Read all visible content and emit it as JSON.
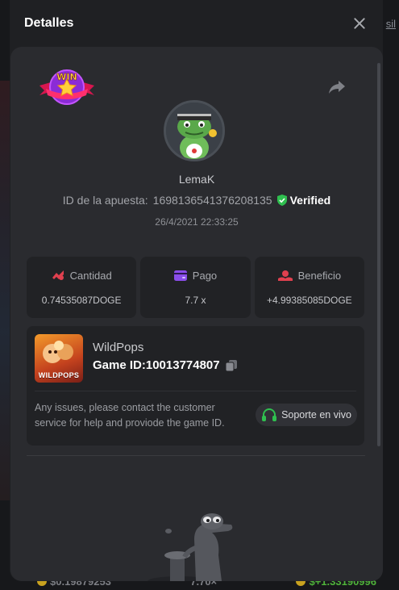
{
  "modal": {
    "title": "Detalles"
  },
  "background": {
    "right_link": "sil",
    "bottom_left_value": "$0.19879253",
    "bottom_mid_value": "7.70×",
    "bottom_right_value": "$+1.33190996"
  },
  "bet": {
    "badge": "WIN",
    "username": "LemaK",
    "bet_id_label": "ID de la apuesta:",
    "bet_id": "1698136541376208135",
    "verified_label": "Verified",
    "timestamp": "26/4/2021 22:33:25"
  },
  "stats": [
    {
      "label": "Cantidad",
      "value": "0.74535087DOGE",
      "icon": "wager-icon",
      "color": "#e0404f"
    },
    {
      "label": "Pago",
      "value": "7.7 x",
      "icon": "wallet-icon",
      "color": "#8a4dea"
    },
    {
      "label": "Beneficio",
      "value": "+4.99385085DOGE",
      "icon": "profit-icon",
      "color": "#e0404f"
    }
  ],
  "game": {
    "thumb_label": "WILDPOPS",
    "name": "WildPops",
    "id_label": "Game ID:10013774807",
    "issues_text": "Any issues, please contact the customer service for help and proviode the game ID.",
    "support_label": "Soporte en vivo"
  },
  "colors": {
    "accent_green": "#2fbf4f",
    "verified_green": "#2fbf4f",
    "card_bg": "#2a2b2f"
  }
}
